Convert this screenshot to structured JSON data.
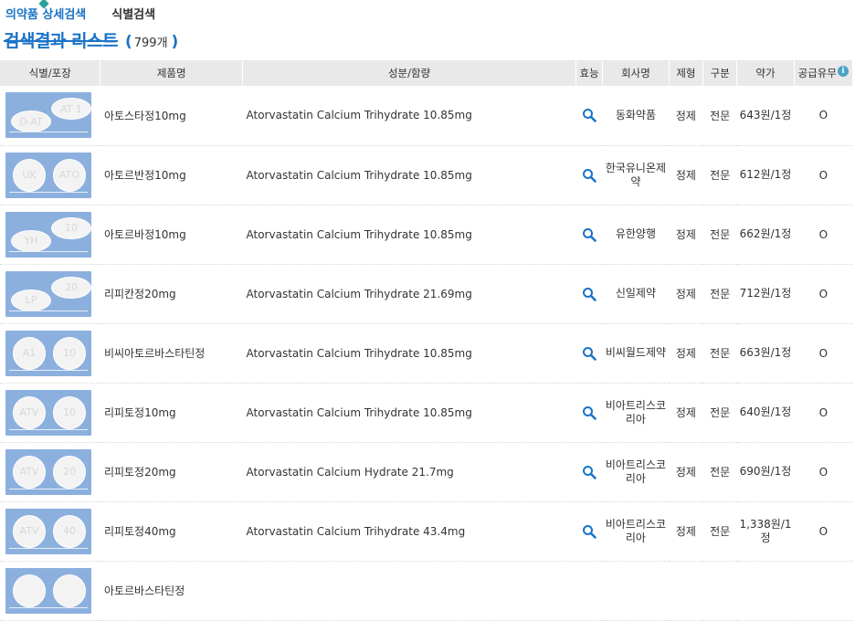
{
  "tabs": [
    {
      "label": "의약품 상세검색",
      "active": true
    },
    {
      "label": "식별검색",
      "active": false
    }
  ],
  "result": {
    "title": "검색결과 리스트",
    "open": "(",
    "count": "799개",
    "close": ")"
  },
  "headers": {
    "id": "식별/포장",
    "name": "제품명",
    "ingredient": "성분/함량",
    "effect": "효능",
    "company": "회사명",
    "form": "제형",
    "category": "구분",
    "price": "약가",
    "supply": "공급유무"
  },
  "colors": {
    "accent": "#1a73c7",
    "thumb_bg": "#8cb0de",
    "header_bg": "#e9e9e9",
    "info": "#4aa3c8"
  },
  "icons": {
    "effect": "search-icon",
    "supply_info": "info-icon"
  },
  "rows": [
    {
      "name": "아토스타정10mg",
      "ingredient": "Atorvastatin Calcium Trihydrate 10.85mg",
      "company": "동화약품",
      "form": "정제",
      "category": "전문",
      "price": "643원/1정",
      "supply": "O",
      "thumb": "ovals",
      "mark_a": "D-AT",
      "mark_b": "AT 1"
    },
    {
      "name": "아토르반정10mg",
      "ingredient": "Atorvastatin Calcium Trihydrate 10.85mg",
      "company": "한국유니온제약",
      "form": "정제",
      "category": "전문",
      "price": "612원/1정",
      "supply": "O",
      "thumb": "rounds",
      "mark_a": "UK",
      "mark_b": "ATO"
    },
    {
      "name": "아토르바정10mg",
      "ingredient": "Atorvastatin Calcium Trihydrate 10.85mg",
      "company": "유한양행",
      "form": "정제",
      "category": "전문",
      "price": "662원/1정",
      "supply": "O",
      "thumb": "ovals",
      "mark_a": "YH",
      "mark_b": "10"
    },
    {
      "name": "리피칸정20mg",
      "ingredient": "Atorvastatin Calcium Trihydrate 21.69mg",
      "company": "신일제약",
      "form": "정제",
      "category": "전문",
      "price": "712원/1정",
      "supply": "O",
      "thumb": "ovals",
      "mark_a": "LP",
      "mark_b": "20"
    },
    {
      "name": "비씨아토르바스타틴정",
      "ingredient": "Atorvastatin Calcium Trihydrate 10.85mg",
      "company": "비씨월드제약",
      "form": "정제",
      "category": "전문",
      "price": "663원/1정",
      "supply": "O",
      "thumb": "rounds",
      "mark_a": "A1",
      "mark_b": "10"
    },
    {
      "name": "리피토정10mg",
      "ingredient": "Atorvastatin Calcium Trihydrate 10.85mg",
      "company": "비아트리스코리아",
      "form": "정제",
      "category": "전문",
      "price": "640원/1정",
      "supply": "O",
      "thumb": "rounds",
      "mark_a": "ATV",
      "mark_b": "10"
    },
    {
      "name": "리피토정20mg",
      "ingredient": "Atorvastatin Calcium Hydrate 21.7mg",
      "company": "비아트리스코리아",
      "form": "정제",
      "category": "전문",
      "price": "690원/1정",
      "supply": "O",
      "thumb": "rounds",
      "mark_a": "ATV",
      "mark_b": "20"
    },
    {
      "name": "리피토정40mg",
      "ingredient": "Atorvastatin Calcium Trihydrate 43.4mg",
      "company": "비아트리스코리아",
      "form": "정제",
      "category": "전문",
      "price": "1,338원/1정",
      "supply": "O",
      "thumb": "rounds",
      "mark_a": "ATV",
      "mark_b": "40"
    },
    {
      "name": "아토르바스타틴정",
      "ingredient": "",
      "company": "",
      "form": "",
      "category": "",
      "price": "",
      "supply": "",
      "thumb": "rounds",
      "mark_a": "",
      "mark_b": ""
    }
  ]
}
